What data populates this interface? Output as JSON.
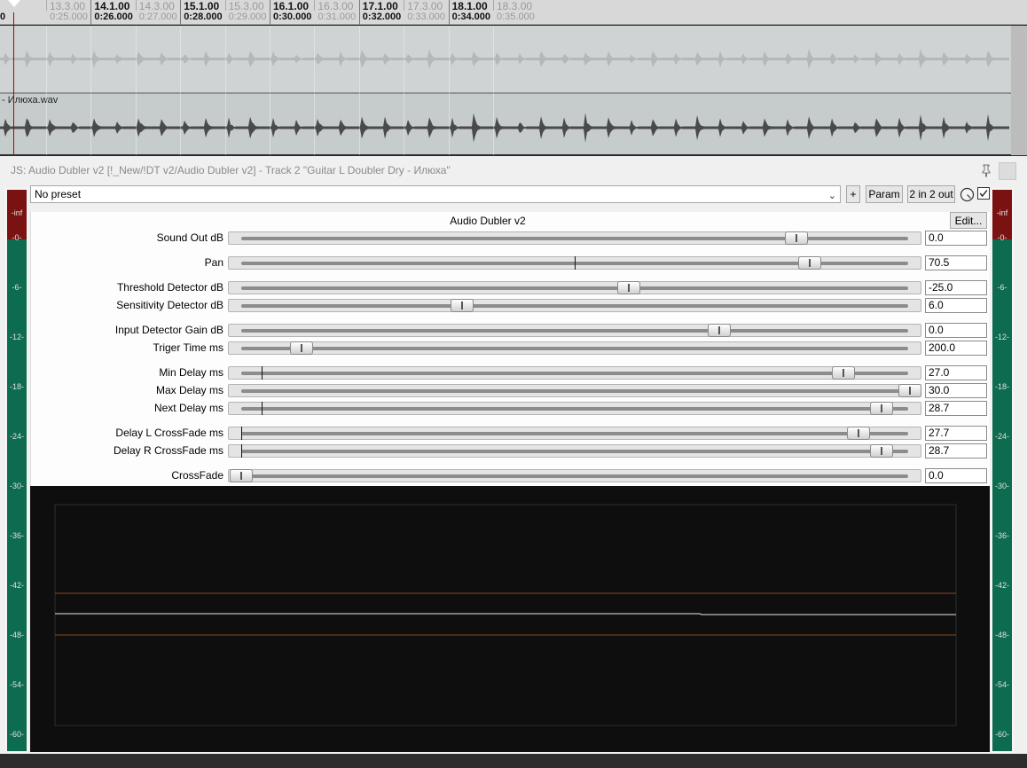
{
  "ruler": {
    "ticks": [
      {
        "measure": "13.3.00",
        "time": "0:25.000",
        "minor": true
      },
      {
        "measure": "14.1.00",
        "time": "0:26.000",
        "minor": false
      },
      {
        "measure": "14.3.00",
        "time": "0:27.000",
        "minor": true
      },
      {
        "measure": "15.1.00",
        "time": "0:28.000",
        "minor": false
      },
      {
        "measure": "15.3.00",
        "time": "0:29.000",
        "minor": true
      },
      {
        "measure": "16.1.00",
        "time": "0:30.000",
        "minor": false
      },
      {
        "measure": "16.3.00",
        "time": "0:31.000",
        "minor": true
      },
      {
        "measure": "17.1.00",
        "time": "0:32.000",
        "minor": false
      },
      {
        "measure": "17.3.00",
        "time": "0:33.000",
        "minor": true
      },
      {
        "measure": "18.1.00",
        "time": "0:34.000",
        "minor": false
      },
      {
        "measure": "18.3.00",
        "time": "0:35.000",
        "minor": true
      }
    ],
    "left_stub": "0"
  },
  "tracks": {
    "track2_item": "- Илюха.wav"
  },
  "plugin": {
    "title": "JS: Audio Dubler v2 [!_New/!DT v2/Audio Dubler v2] - Track 2 \"Guitar  L Doubler Dry - Илюха\"",
    "preset": "No preset",
    "plus_label": "+",
    "param_label": "Param",
    "io_label": "2 in 2 out",
    "effect_name": "Audio Dubler v2",
    "edit_label": "Edit...",
    "sliders": [
      {
        "label": "Sound Out dB",
        "value": "0.0",
        "pos": 0.83,
        "marker": null
      },
      {
        "label": "Pan",
        "value": "70.5",
        "pos": 0.85,
        "marker": 0.5
      },
      {
        "label": "Threshold Detector dB",
        "value": "-25.0",
        "pos": 0.58,
        "marker": null
      },
      {
        "label": "Sensitivity Detector dB",
        "value": "6.0",
        "pos": 0.33,
        "marker": null
      },
      {
        "label": "Input Detector Gain dB",
        "value": "0.0",
        "pos": 0.715,
        "marker": null
      },
      {
        "label": "Triger Time ms",
        "value": "200.0",
        "pos": 0.09,
        "marker": null
      },
      {
        "label": "Min Delay ms",
        "value": "27.0",
        "pos": 0.9,
        "marker": 0.03
      },
      {
        "label": "Max Delay ms",
        "value": "30.0",
        "pos": 1.0,
        "marker": null
      },
      {
        "label": "Next Delay ms",
        "value": "28.7",
        "pos": 0.957,
        "marker": 0.03
      },
      {
        "label": "Delay L CrossFade ms",
        "value": "27.7",
        "pos": 0.923,
        "marker": 0.0
      },
      {
        "label": "Delay R CrossFade ms",
        "value": "28.7",
        "pos": 0.957,
        "marker": 0.0
      },
      {
        "label": "CrossFade",
        "value": "0.0",
        "pos": 0.0,
        "marker": null
      }
    ]
  },
  "meters": {
    "top_label": "-inf",
    "scale": [
      "-0-",
      "-6-",
      "-12-",
      "-18-",
      "-24-",
      "-30-",
      "-36-",
      "-42-",
      "-48-",
      "-54-",
      "-60-"
    ]
  },
  "colors": {
    "meter_green": "#0d6b4f",
    "meter_clip": "#7a1212",
    "graph_bg": "#0e0e0e",
    "graph_threshold": "#8a4a1a"
  }
}
